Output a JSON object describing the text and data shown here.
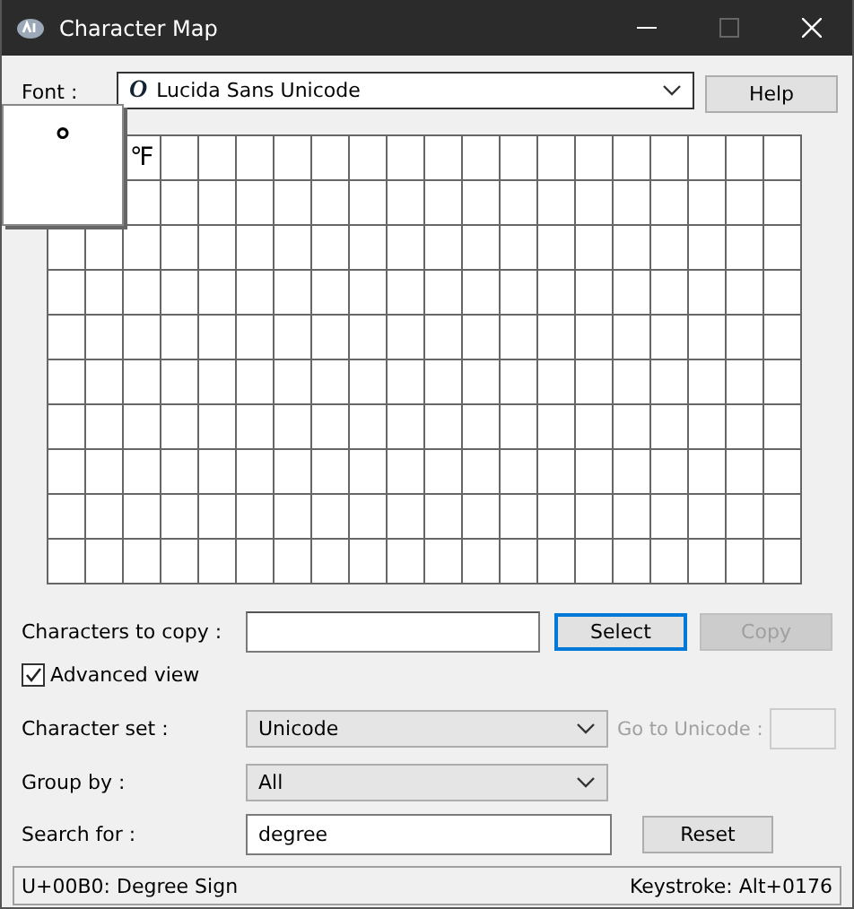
{
  "window": {
    "title": "Character Map"
  },
  "font": {
    "label": "Font :",
    "glyph": "O",
    "value": "Lucida Sans Unicode"
  },
  "help_button": "Help",
  "grid": {
    "magnified_character": "°",
    "visible_characters": [
      "℉"
    ]
  },
  "copy": {
    "label": "Characters to copy :",
    "select_button": "Select",
    "copy_button": {
      "label": "Copy",
      "disabled": true
    }
  },
  "advanced_view": {
    "label": "Advanced view",
    "checked": true
  },
  "character_set": {
    "label": "Character set :",
    "value": "Unicode"
  },
  "go_to_unicode": {
    "label": "Go to Unicode :",
    "disabled": true
  },
  "group_by": {
    "label": "Group by :",
    "value": "All"
  },
  "search": {
    "label": "Search for :",
    "value": "degree",
    "reset_button": "Reset"
  },
  "status_bar": {
    "info": "U+00B0: Degree Sign",
    "keystroke": "Keystroke: Alt+0176"
  }
}
